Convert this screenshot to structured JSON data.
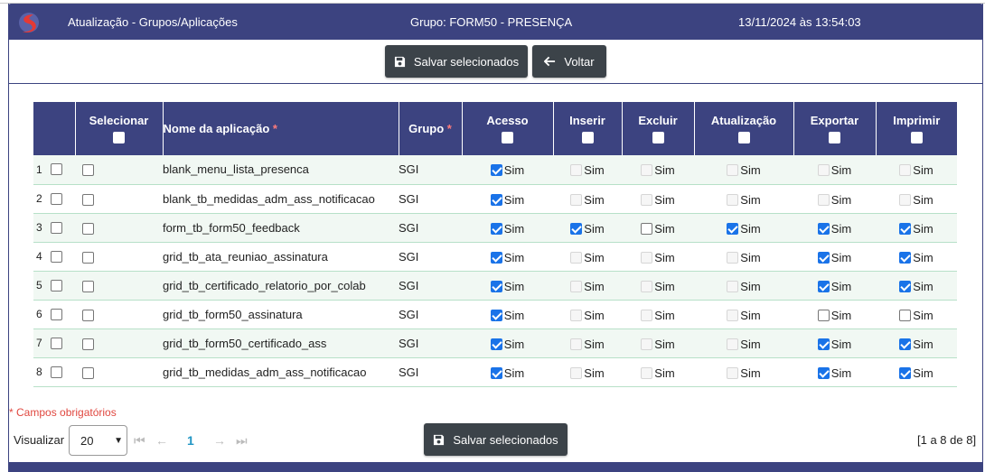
{
  "header": {
    "title": "Atualização - Grupos/Aplicações",
    "group": "Grupo: FORM50 - PRESENÇA",
    "datetime": "13/11/2024 às 13:54:03"
  },
  "toolbar": {
    "save_label": "Salvar selecionados",
    "back_label": "Voltar"
  },
  "table": {
    "columns": {
      "select": "Selecionar",
      "app_name": "Nome da aplicação",
      "group": "Grupo",
      "access": "Acesso",
      "insert": "Inserir",
      "delete": "Excluir",
      "update": "Atualização",
      "export": "Exportar",
      "print": "Imprimir"
    },
    "required_mark": "*",
    "perm_label": "Sim",
    "rows": [
      {
        "num": "1",
        "name": "blank_menu_lista_presenca",
        "group": "SGI",
        "perms": [
          true,
          null,
          null,
          null,
          null,
          null
        ]
      },
      {
        "num": "2",
        "name": "blank_tb_medidas_adm_ass_notificacao",
        "group": "SGI",
        "perms": [
          true,
          null,
          null,
          null,
          null,
          null
        ]
      },
      {
        "num": "3",
        "name": "form_tb_form50_feedback",
        "group": "SGI",
        "perms": [
          true,
          true,
          false,
          true,
          true,
          true
        ]
      },
      {
        "num": "4",
        "name": "grid_tb_ata_reuniao_assinatura",
        "group": "SGI",
        "perms": [
          true,
          null,
          null,
          null,
          true,
          true
        ]
      },
      {
        "num": "5",
        "name": "grid_tb_certificado_relatorio_por_colab",
        "group": "SGI",
        "perms": [
          true,
          null,
          null,
          null,
          true,
          true
        ]
      },
      {
        "num": "6",
        "name": "grid_tb_form50_assinatura",
        "group": "SGI",
        "perms": [
          true,
          null,
          null,
          null,
          false,
          false
        ]
      },
      {
        "num": "7",
        "name": "grid_tb_form50_certificado_ass",
        "group": "SGI",
        "perms": [
          true,
          null,
          null,
          null,
          true,
          true
        ]
      },
      {
        "num": "8",
        "name": "grid_tb_medidas_adm_ass_notificacao",
        "group": "SGI",
        "perms": [
          true,
          null,
          null,
          null,
          true,
          true
        ]
      }
    ]
  },
  "footer": {
    "required_note": "* Campos obrigatórios",
    "visualizar_label": "Visualizar",
    "page_size": "20",
    "current_page": "1",
    "range": "[1 a 8 de 8]",
    "save_label": "Salvar selecionados"
  },
  "colors": {
    "brand": "#3c4380",
    "button": "#3c4349",
    "checkbox": "#1a73e8",
    "required": "#e0473f"
  }
}
